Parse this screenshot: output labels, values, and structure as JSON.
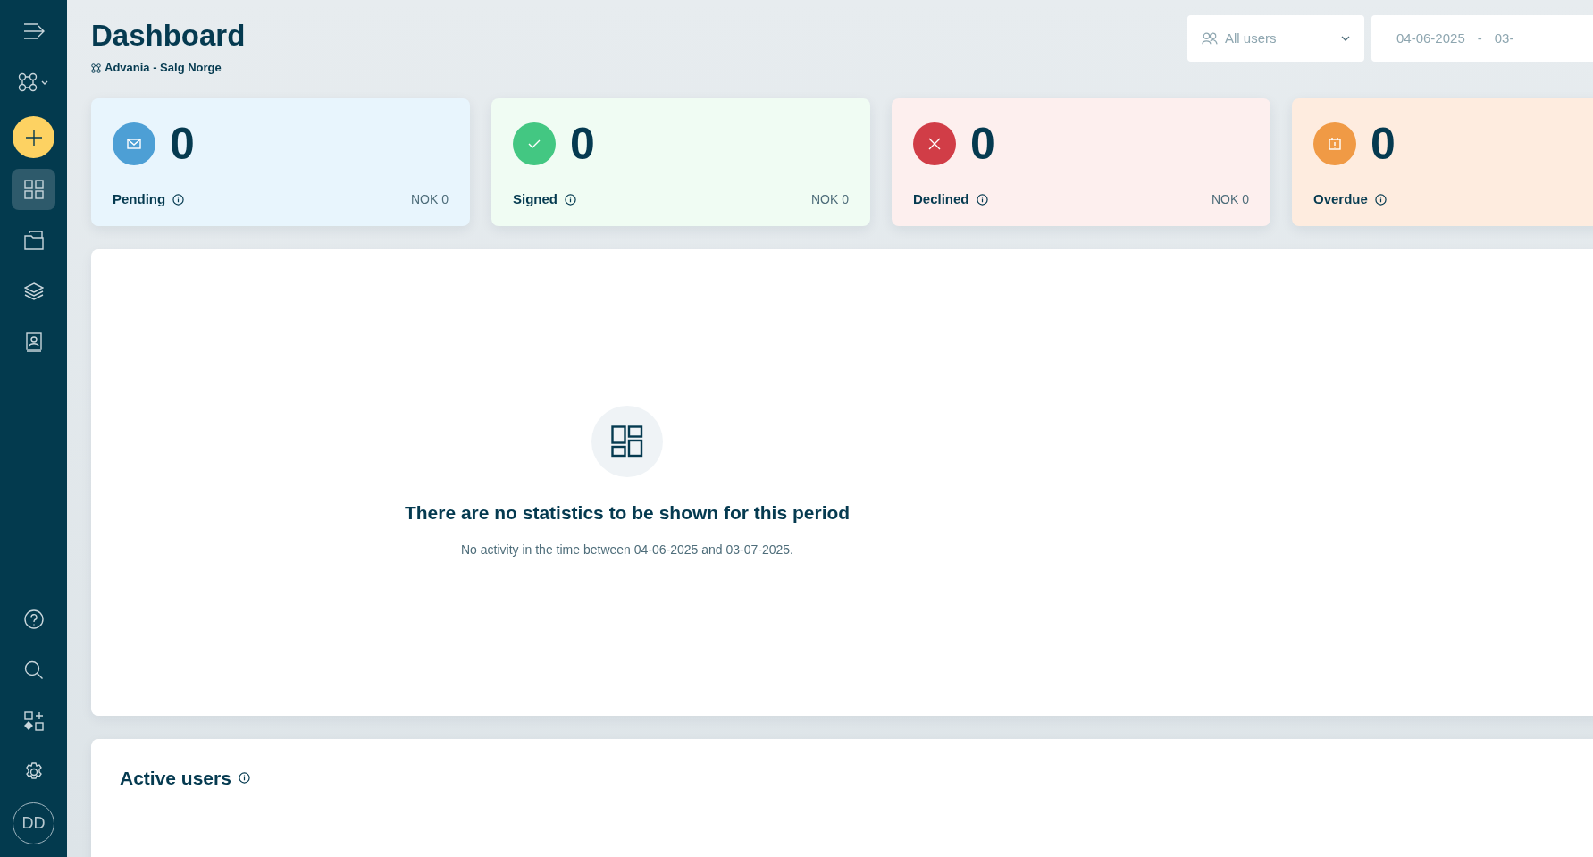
{
  "sidebar": {
    "top_items": [
      {
        "kind": "menu",
        "selected": false
      },
      {
        "kind": "organization",
        "selected": false
      },
      {
        "kind": "add",
        "selected": false
      },
      {
        "kind": "dashboard",
        "selected": true
      },
      {
        "kind": "folder",
        "selected": false
      },
      {
        "kind": "layers",
        "selected": false
      },
      {
        "kind": "contacts",
        "selected": false
      }
    ],
    "bottom_items": [
      {
        "kind": "help",
        "selected": false
      },
      {
        "kind": "search",
        "selected": false
      },
      {
        "kind": "widgets",
        "selected": false
      },
      {
        "kind": "settings",
        "selected": false
      }
    ],
    "avatar": "DD"
  },
  "header": {
    "title": "Dashboard",
    "organization": "Advania - Salg Norge",
    "user_filter": "All users",
    "date_from": "04-06-2025",
    "date_separator": "-",
    "date_to": "03-"
  },
  "stat_cards": [
    {
      "kind": "pending",
      "count": "0",
      "label": "Pending",
      "amount": "NOK 0"
    },
    {
      "kind": "signed",
      "count": "0",
      "label": "Signed",
      "amount": "NOK 0"
    },
    {
      "kind": "declined",
      "count": "0",
      "label": "Declined",
      "amount": "NOK 0"
    },
    {
      "kind": "overdue",
      "count": "0",
      "label": "Overdue"
    }
  ],
  "statistics": {
    "empty_title": "There are no statistics to be shown for this period",
    "empty_text": "No activity in the time between 04-06-2025 and 03-07-2025."
  },
  "active_users": {
    "title": "Active users"
  }
}
